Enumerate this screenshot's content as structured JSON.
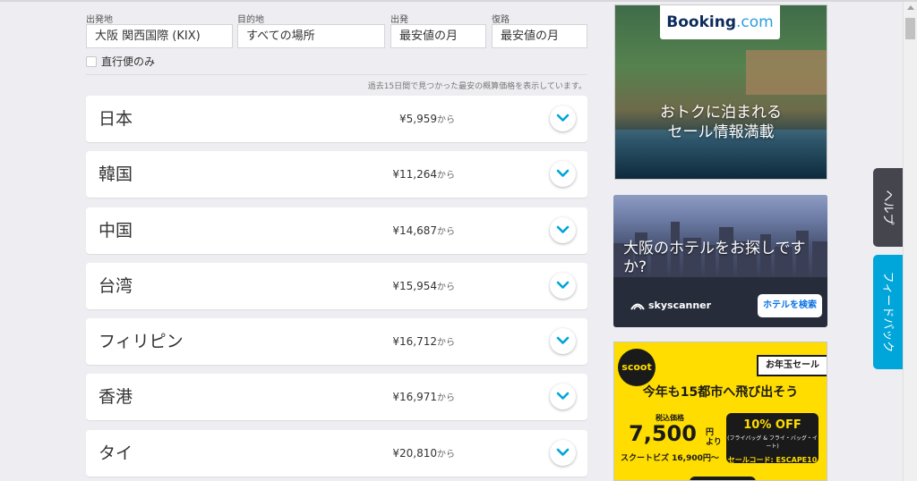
{
  "search": {
    "origin_label": "出発地",
    "origin_value": "大阪 関西国際 (KIX)",
    "destination_label": "目的地",
    "destination_value": "すべての場所",
    "depart_label": "出発",
    "depart_value": "最安値の月",
    "return_label": "復路",
    "return_value": "最安値の月",
    "direct_only_label": "直行便のみ",
    "direct_only_checked": false
  },
  "notice": "過去15日間で見つかった最安の概算価格を表示しています。",
  "results": [
    {
      "country": "日本",
      "price": "¥5,959",
      "suffix": "から"
    },
    {
      "country": "韓国",
      "price": "¥11,264",
      "suffix": "から"
    },
    {
      "country": "中国",
      "price": "¥14,687",
      "suffix": "から"
    },
    {
      "country": "台湾",
      "price": "¥15,954",
      "suffix": "から"
    },
    {
      "country": "フィリピン",
      "price": "¥16,712",
      "suffix": "から"
    },
    {
      "country": "香港",
      "price": "¥16,971",
      "suffix": "から"
    },
    {
      "country": "タイ",
      "price": "¥20,810",
      "suffix": "から"
    }
  ],
  "ads": {
    "booking": {
      "logo_main": "Booking",
      "logo_dot": ".com",
      "line1": "おトクに泊まれる",
      "line2": "セール情報満載"
    },
    "skyscanner": {
      "headline": "大阪のホテルをお探しですか?",
      "logo": "skyscanner",
      "button": "ホテルを検索"
    },
    "scoot": {
      "logo": "scoot",
      "tag": "お年玉セール",
      "headline": "今年も15都市へ飛び出そう",
      "tax_label": "税込価格",
      "price": "7,500",
      "yen": "円",
      "yori": "より",
      "biz": "スクートビズ 16,900円〜",
      "off": "10% OFF",
      "off_sub": "(フライバッグ & フライ・バッグ・イート)",
      "code": "セールコード: ESCAPE10"
    }
  },
  "side_tabs": {
    "help": "ヘルプ",
    "feedback": "フィードバック"
  },
  "colors": {
    "accent": "#00a5d9",
    "help_tab": "#44454d",
    "chevron": "#00a5d9"
  }
}
